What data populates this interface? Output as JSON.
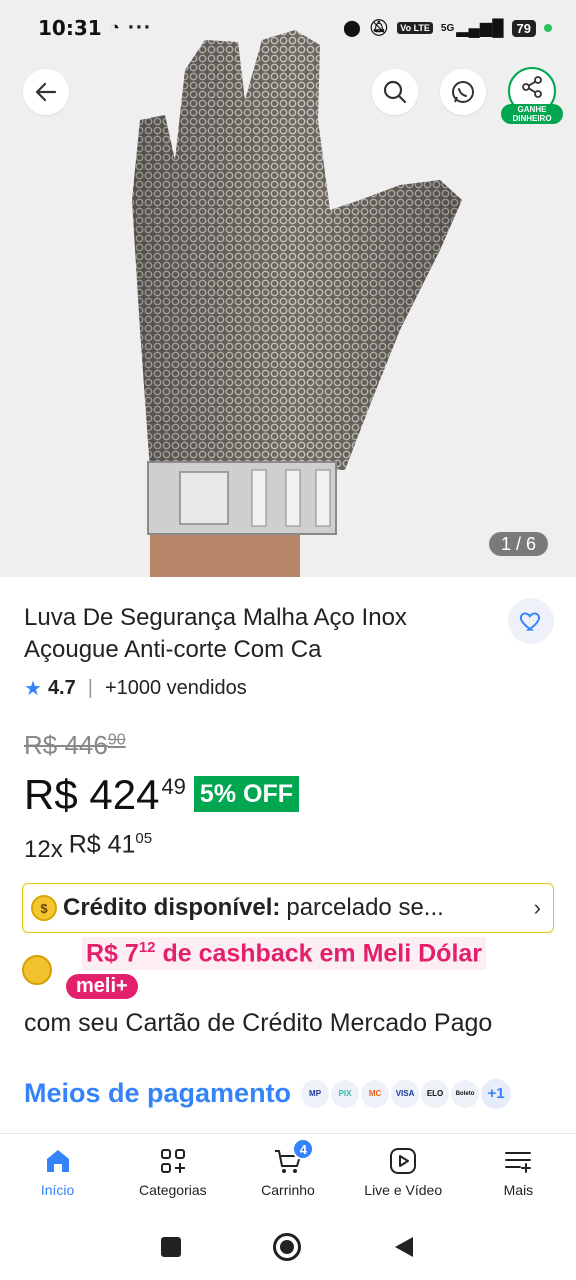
{
  "status_bar": {
    "time": "10:31",
    "dots": "···",
    "network": "5G",
    "battery": "79",
    "lte": "Vo LTE"
  },
  "icons": {
    "back": "arrow-left-icon",
    "search": "search-icon",
    "chat": "whatsapp-icon",
    "share": "share-icon",
    "favorite": "heart-icon",
    "rating_star": "star-icon",
    "credit_coin": "coin-icon",
    "cashback_coin": "meli-dollar-coin-icon",
    "chevron": "chevron-right-icon",
    "home": "home-icon",
    "categories": "categories-icon",
    "cart": "cart-icon",
    "live": "play-video-icon",
    "more": "menu-plus-icon"
  },
  "header": {
    "share_label": "GANHE DINHEIRO",
    "image_counter": "1 / 6"
  },
  "product": {
    "title": "Luva De Segurança Malha Aço Inox Açougue Anti-corte Com Ca",
    "rating": "4.7",
    "sold": "+1000 vendidos",
    "old_price_main": "R$ 446",
    "old_price_cents": "90",
    "price_main": "R$ 424",
    "price_cents": "49",
    "discount": "5% OFF",
    "installment_count": "12x",
    "installment_main": "R$ 41",
    "installment_cents": "05"
  },
  "credit": {
    "label": "Crédito disponível:",
    "text": "parcelado se...",
    "coin_symbol": "$"
  },
  "cashback": {
    "amount_main": "R$ 7",
    "amount_cents": "12",
    "text": "de cashback em Meli Dólar",
    "badge": "meli+",
    "card_text": "com seu Cartão de Crédito Mercado Pago"
  },
  "payments": {
    "link": "Meios de pagamento",
    "methods": [
      "MP",
      "PIX",
      "MC",
      "VISA",
      "ELO",
      "Boleto"
    ],
    "more": "+1"
  },
  "bottom_nav": [
    {
      "label": "Início",
      "active": true
    },
    {
      "label": "Categorias",
      "active": false
    },
    {
      "label": "Carrinho",
      "active": false,
      "badge": "4"
    },
    {
      "label": "Live e Vídeo",
      "active": false
    },
    {
      "label": "Mais",
      "active": false
    }
  ],
  "colors": {
    "accent": "#3483fa",
    "green": "#00a650",
    "meli_pink": "#e3206b",
    "credit_border": "#e5c700"
  }
}
